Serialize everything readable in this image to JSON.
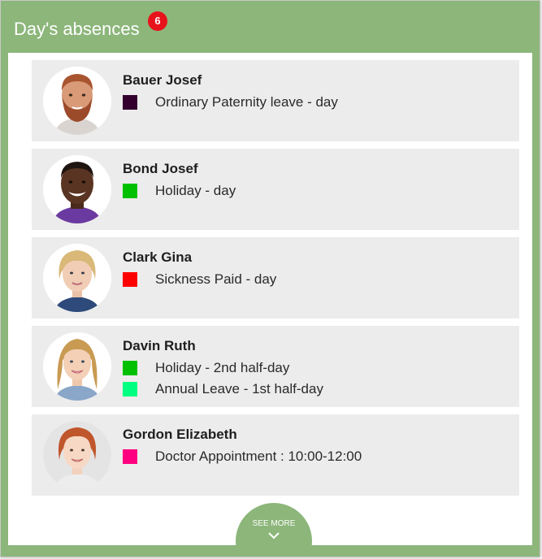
{
  "header": {
    "title": "Day's absences",
    "badge_count": "6",
    "color": "#8cb67a"
  },
  "absences": [
    {
      "name": "Bauer Josef",
      "avatar": "bearded-man-portrait",
      "items": [
        {
          "label": "Ordinary Paternity leave - day",
          "color": "#33002e"
        }
      ]
    },
    {
      "name": "Bond Josef",
      "avatar": "smiling-man-portrait",
      "items": [
        {
          "label": "Holiday - day",
          "color": "#00c000"
        }
      ]
    },
    {
      "name": "Clark Gina",
      "avatar": "blonde-woman-portrait",
      "items": [
        {
          "label": "Sickness Paid - day",
          "color": "#ff0000"
        }
      ]
    },
    {
      "name": "Davin Ruth",
      "avatar": "blonde-woman-long-hair-portrait",
      "items": [
        {
          "label": "Holiday - 2nd half-day",
          "color": "#00c000"
        },
        {
          "label": "Annual Leave - 1st half-day",
          "color": "#00ff80"
        }
      ]
    },
    {
      "name": "Gordon Elizabeth",
      "avatar": "red-haired-woman-portrait",
      "items": [
        {
          "label": "Doctor Appointment : 10:00-12:00",
          "color": "#ff0080"
        }
      ]
    }
  ],
  "see_more": {
    "label": "SEE MORE",
    "icon": "chevron-down-icon"
  }
}
